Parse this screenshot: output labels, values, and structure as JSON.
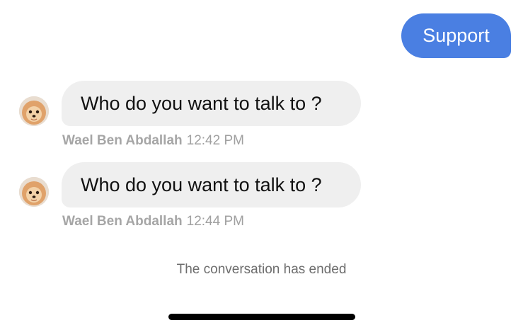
{
  "outgoing": {
    "text": "Support",
    "color": "#4a7fe2"
  },
  "messages": [
    {
      "text": "Who do you want to talk to ?",
      "sender": "Wael Ben Abdallah",
      "time": "12:42 PM",
      "avatar_icon": "pomeranian-dog-avatar"
    },
    {
      "text": "Who do you want to talk to ?",
      "sender": "Wael Ben Abdallah",
      "time": "12:44 PM",
      "avatar_icon": "pomeranian-dog-avatar"
    }
  ],
  "system": {
    "ended_text": "The conversation has ended"
  }
}
